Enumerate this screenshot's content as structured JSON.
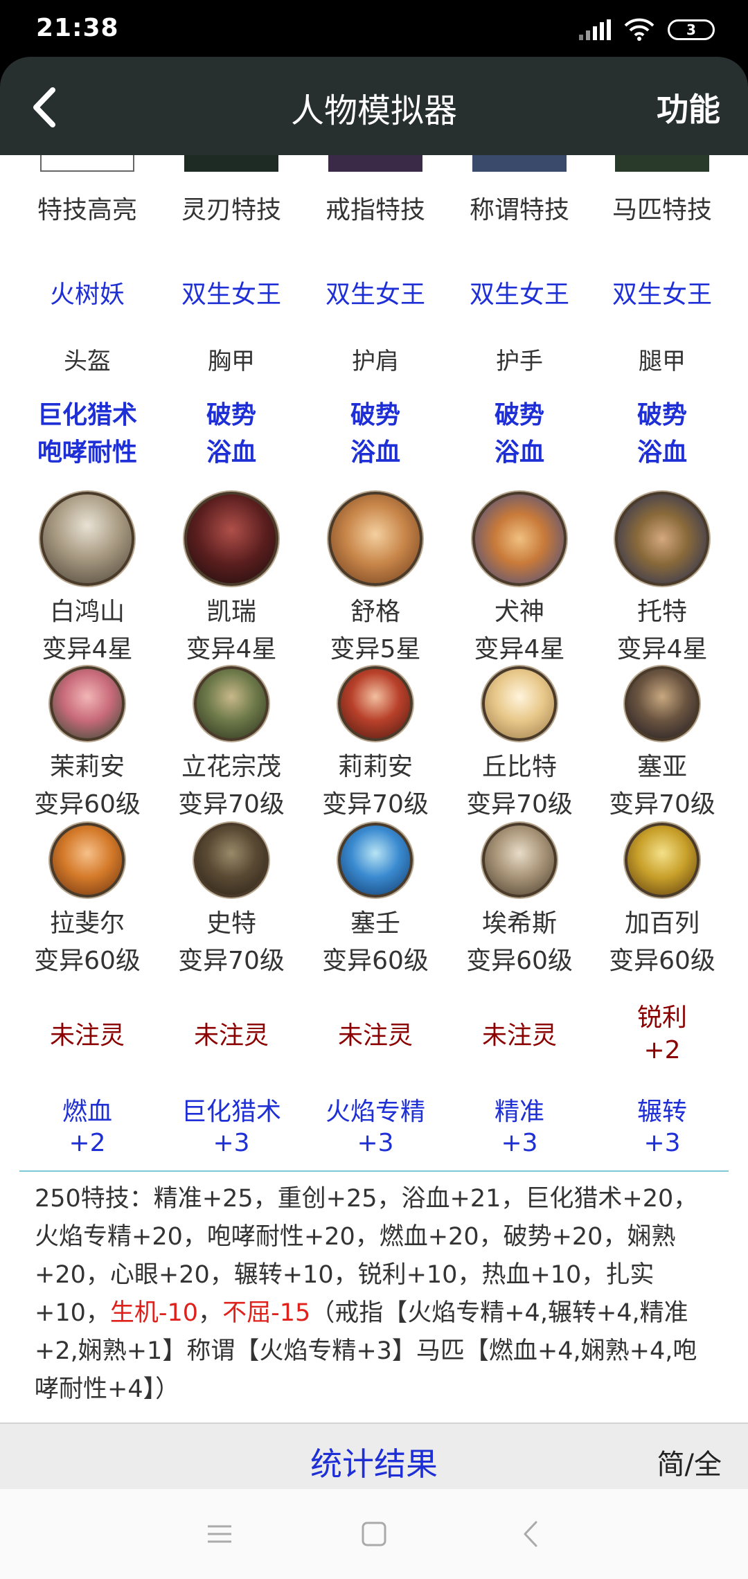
{
  "status_bar": {
    "time": "21:38",
    "battery": "3"
  },
  "header": {
    "title": "人物模拟器",
    "function_label": "功能"
  },
  "columns": [
    {
      "stunt_label": "特技高亮",
      "stunt_value": "火树妖",
      "equip_label": "头盔",
      "equip_effects": [
        "巨化猎术",
        "咆哮耐性"
      ],
      "hero1": {
        "name": "白鸿山",
        "level": "变异4星"
      },
      "hero2": {
        "name": "茉莉安",
        "level": "变异60级"
      },
      "hero3": {
        "name": "拉斐尔",
        "level": "变异60级"
      },
      "infuse": "未注灵",
      "bonus": [
        "燃血",
        "+2"
      ]
    },
    {
      "stunt_label": "灵刃特技",
      "stunt_value": "双生女王",
      "equip_label": "胸甲",
      "equip_effects": [
        "破势",
        "浴血"
      ],
      "hero1": {
        "name": "凯瑞",
        "level": "变异4星"
      },
      "hero2": {
        "name": "立花宗茂",
        "level": "变异70级"
      },
      "hero3": {
        "name": "史特",
        "level": "变异70级"
      },
      "infuse": "未注灵",
      "bonus": [
        "巨化猎术",
        "+3"
      ]
    },
    {
      "stunt_label": "戒指特技",
      "stunt_value": "双生女王",
      "equip_label": "护肩",
      "equip_effects": [
        "破势",
        "浴血"
      ],
      "hero1": {
        "name": "舒格",
        "level": "变异5星"
      },
      "hero2": {
        "name": "莉莉安",
        "level": "变异70级"
      },
      "hero3": {
        "name": "塞壬",
        "level": "变异60级"
      },
      "infuse": "未注灵",
      "bonus": [
        "火焰专精",
        "+3"
      ]
    },
    {
      "stunt_label": "称谓特技",
      "stunt_value": "双生女王",
      "equip_label": "护手",
      "equip_effects": [
        "破势",
        "浴血"
      ],
      "hero1": {
        "name": "犬神",
        "level": "变异4星"
      },
      "hero2": {
        "name": "丘比特",
        "level": "变异70级"
      },
      "hero3": {
        "name": "埃希斯",
        "level": "变异60级"
      },
      "infuse": "未注灵",
      "bonus": [
        "精准",
        "+3"
      ]
    },
    {
      "stunt_label": "马匹特技",
      "stunt_value": "双生女王",
      "equip_label": "腿甲",
      "equip_effects": [
        "破势",
        "浴血"
      ],
      "hero1": {
        "name": "托特",
        "level": "变异4星"
      },
      "hero2": {
        "name": "塞亚",
        "level": "变异70级"
      },
      "hero3": {
        "name": "加百列",
        "level": "变异60级"
      },
      "infuse": "锐利",
      "infuse2": "+2",
      "bonus": [
        "辗转",
        "+3"
      ]
    }
  ],
  "summary": {
    "part1": "250特技：精准+25，重创+25，浴血+21，巨化猎术+20，火焰专精+20，咆哮耐性+20，燃血+20，破势+20，娴熟+20，心眼+20，辗转+10，锐利+10，热血+10，扎实+10，",
    "part_red1": "生机-10",
    "sep": "，",
    "part_red2": "不屈-15",
    "part2": "（戒指【火焰专精+4,辗转+4,精准+2,娴熟+1】称谓【火焰专精+3】马匹【燃血+4,娴熟+4,咆哮耐性+4】）"
  },
  "bottom_bar": {
    "stats_label": "统计结果",
    "toggle_label": "简/全"
  },
  "colors": {
    "blue": "#1f2fd6",
    "dark_red": "#8b0000",
    "red": "#e0201a",
    "appbar": "#27302f",
    "divider": "#7fc8d8"
  }
}
